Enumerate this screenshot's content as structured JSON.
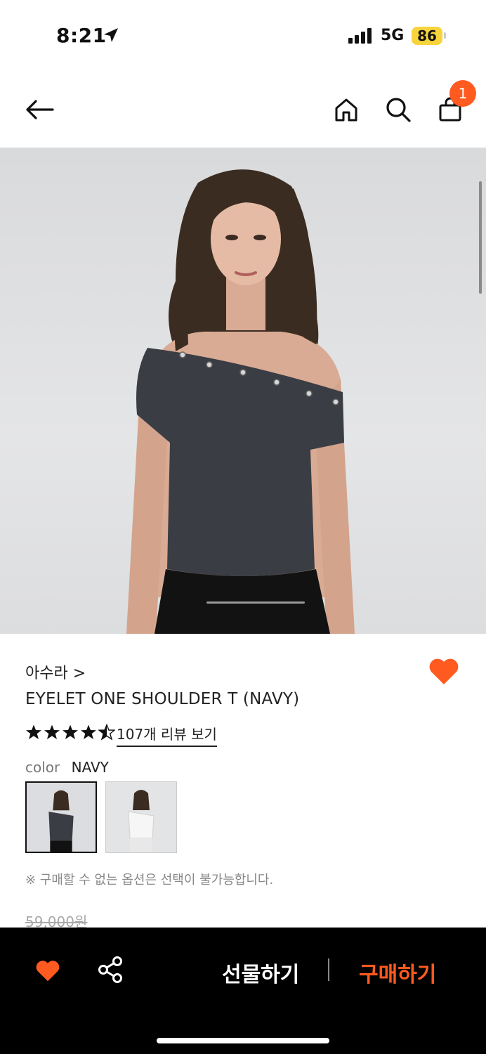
{
  "status_bar": {
    "time": "8:21",
    "network": "5G",
    "battery": "86"
  },
  "nav": {
    "cart_count": "1"
  },
  "product": {
    "brand": "아수라 >",
    "title": "EYELET ONE SHOULDER T (NAVY)",
    "rating": 4.5,
    "review_link": "107개 리뷰 보기",
    "color_label": "color",
    "color_value": "NAVY",
    "notice": "※ 구매할 수 없는 옵션은 선택이 불가능합니다.",
    "original_price": "59,000원"
  },
  "bottom_bar": {
    "gift_label": "선물하기",
    "buy_label": "구매하기"
  },
  "colors": {
    "accent": "#ff5a1f",
    "battery": "#f7d43b",
    "shirt_navy": "#3a3d44"
  }
}
